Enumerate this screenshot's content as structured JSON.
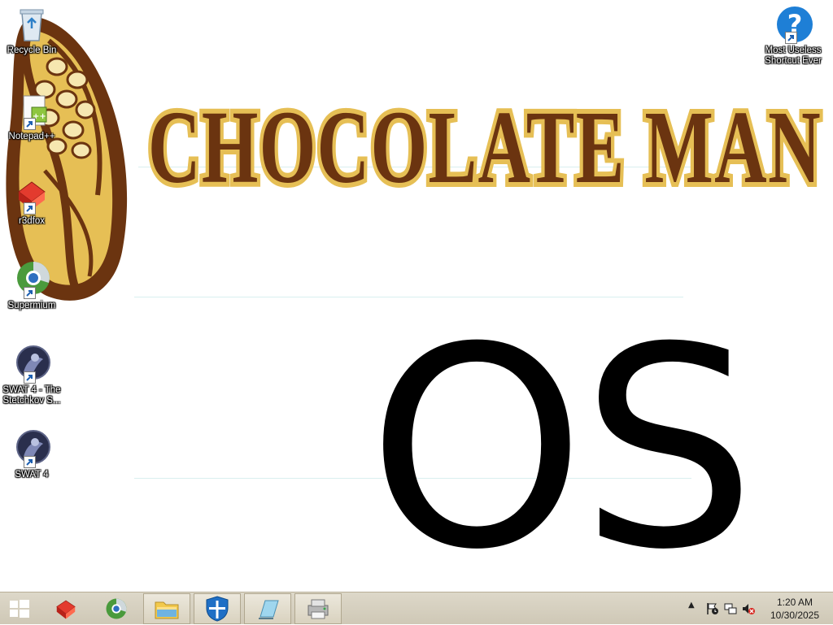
{
  "wallpaper": {
    "brand_title": "CHOCOLATE MAN",
    "subtitle": "OS"
  },
  "desktop_icons": [
    {
      "label": "Recycle Bin",
      "icon": "recycle-bin-icon"
    },
    {
      "label": "Notepad++",
      "icon": "notepad-plus-plus-icon"
    },
    {
      "label": "r3dfox",
      "icon": "r3dfox-icon"
    },
    {
      "label": "Supermium",
      "icon": "supermium-icon"
    },
    {
      "label": "SWAT 4 - The Stetchkov S...",
      "icon": "swat4-expansion-icon"
    },
    {
      "label": "SWAT 4",
      "icon": "swat4-icon"
    },
    {
      "label": "Most Useless Shortcut Ever",
      "icon": "help-question-icon"
    }
  ],
  "taskbar": {
    "buttons": [
      {
        "name": "start",
        "icon": "windows-start-icon"
      },
      {
        "name": "r3dfox",
        "icon": "r3dfox-icon"
      },
      {
        "name": "supermium",
        "icon": "supermium-icon"
      },
      {
        "name": "file-explorer",
        "icon": "folder-icon"
      },
      {
        "name": "windows-defender",
        "icon": "shield-icon"
      },
      {
        "name": "notepad",
        "icon": "notepad-icon"
      },
      {
        "name": "device-manager",
        "icon": "printer-icon"
      }
    ],
    "clock": {
      "time": "1:20 AM",
      "date": "10/30/2025"
    }
  },
  "colors": {
    "cocoa_brown": "#6b3410",
    "cocoa_gold": "#e6bf55",
    "taskbar": "#d6d0c0"
  }
}
